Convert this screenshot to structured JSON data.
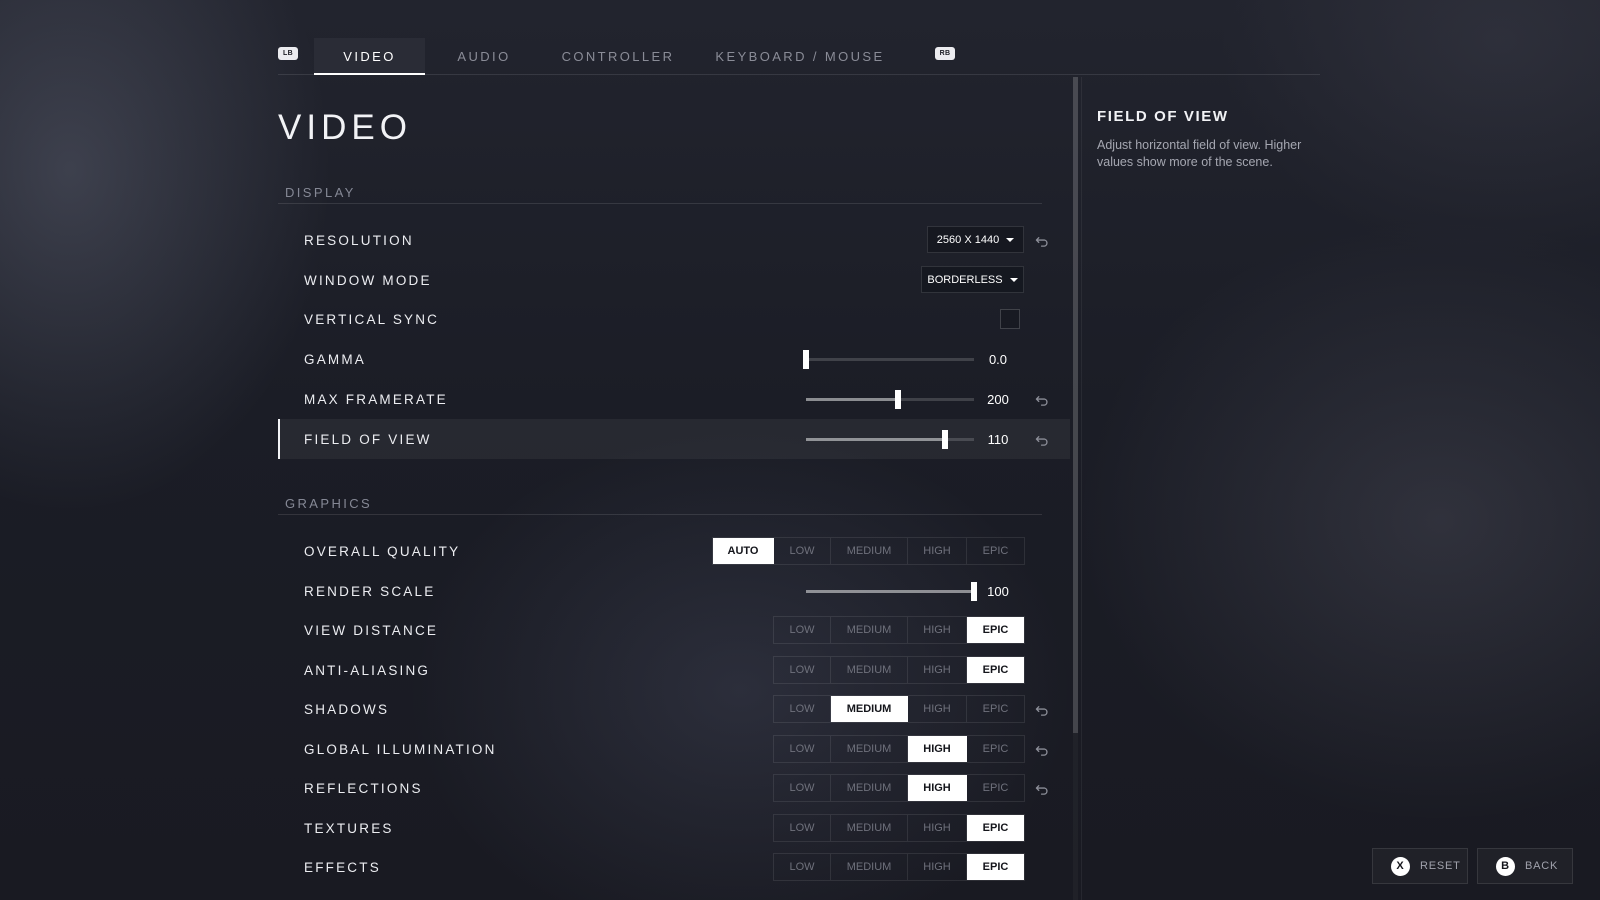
{
  "tabs": {
    "left_bumper": "LB",
    "right_bumper": "RB",
    "items": [
      {
        "label": "VIDEO",
        "active": true
      },
      {
        "label": "AUDIO",
        "active": false
      },
      {
        "label": "CONTROLLER",
        "active": false
      },
      {
        "label": "KEYBOARD / MOUSE",
        "active": false
      }
    ]
  },
  "page": {
    "title": "VIDEO"
  },
  "display": {
    "header": "DISPLAY",
    "resolution": {
      "label": "RESOLUTION",
      "value": "2560 X 1440"
    },
    "window_mode": {
      "label": "WINDOW MODE",
      "value": "BORDERLESS"
    },
    "vertical_sync": {
      "label": "VERTICAL SYNC",
      "checked": false
    },
    "gamma": {
      "label": "GAMMA",
      "value": "0.0",
      "fraction": 0.0
    },
    "max_framerate": {
      "label": "MAX FRAMERATE",
      "value": "200",
      "fraction": 0.55
    },
    "field_of_view": {
      "label": "FIELD OF VIEW",
      "value": "110",
      "fraction": 0.83
    }
  },
  "graphics": {
    "header": "GRAPHICS",
    "levels": {
      "auto": "AUTO",
      "low": "LOW",
      "medium": "MEDIUM",
      "high": "HIGH",
      "epic": "EPIC"
    },
    "overall_quality": {
      "label": "OVERALL QUALITY",
      "selected": "AUTO"
    },
    "render_scale": {
      "label": "RENDER SCALE",
      "value": "100",
      "fraction": 1.0
    },
    "view_distance": {
      "label": "VIEW DISTANCE",
      "selected": "EPIC"
    },
    "anti_aliasing": {
      "label": "ANTI-ALIASING",
      "selected": "EPIC"
    },
    "shadows": {
      "label": "SHADOWS",
      "selected": "MEDIUM"
    },
    "global_illumination": {
      "label": "GLOBAL ILLUMINATION",
      "selected": "HIGH"
    },
    "reflections": {
      "label": "REFLECTIONS",
      "selected": "HIGH"
    },
    "textures": {
      "label": "TEXTURES",
      "selected": "EPIC"
    },
    "effects": {
      "label": "EFFECTS",
      "selected": "EPIC"
    }
  },
  "info": {
    "title": "FIELD OF VIEW",
    "description": "Adjust horizontal field of view. Higher values show more of the scene."
  },
  "footer": {
    "reset": {
      "glyph": "X",
      "label": "RESET"
    },
    "back": {
      "glyph": "B",
      "label": "BACK"
    }
  },
  "colors": {
    "selected": "#ffffff",
    "accent_text": "#ecedf1",
    "muted": "#6f717c"
  }
}
